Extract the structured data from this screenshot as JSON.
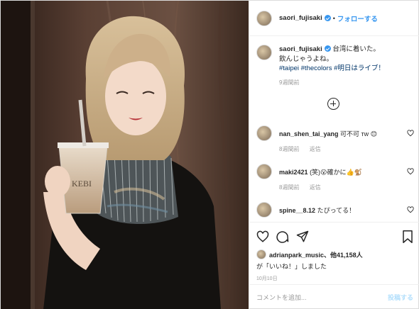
{
  "header": {
    "username": "saori_fujisaki",
    "dot": "•",
    "follow_label": "フォローする"
  },
  "caption": {
    "username": "saori_fujisaki",
    "line1": "台湾に着いた。",
    "line2": "飲んじゃうよね。",
    "tag1": "#taipei",
    "tag2": "#thecolors",
    "tag3": "#明日はライブ！",
    "time": "9週間前"
  },
  "comments": [
    {
      "username": "nan_shen_tai_yang",
      "text": "可不可 ᴛᴡ 😊",
      "time": "8週間前",
      "reply": "返信"
    },
    {
      "username": "maki2421",
      "text": "(笑)😮確かに👍🐒",
      "time": "8週間前",
      "reply": "返信"
    },
    {
      "username": "spine__8.12",
      "text": "たぴってる！"
    }
  ],
  "likes": {
    "line1_user": "adrianpark_music",
    "line1_rest": "、他41,158人",
    "line2": "が「いいね！」しました"
  },
  "date": "10月10日",
  "add_comment": {
    "placeholder": "コメントを追加...",
    "post_label": "投稿する"
  },
  "photo": {
    "cup_text": "KEBI"
  },
  "colors": {
    "link": "#3897f0",
    "hashtag": "#003569",
    "muted": "#999999"
  }
}
